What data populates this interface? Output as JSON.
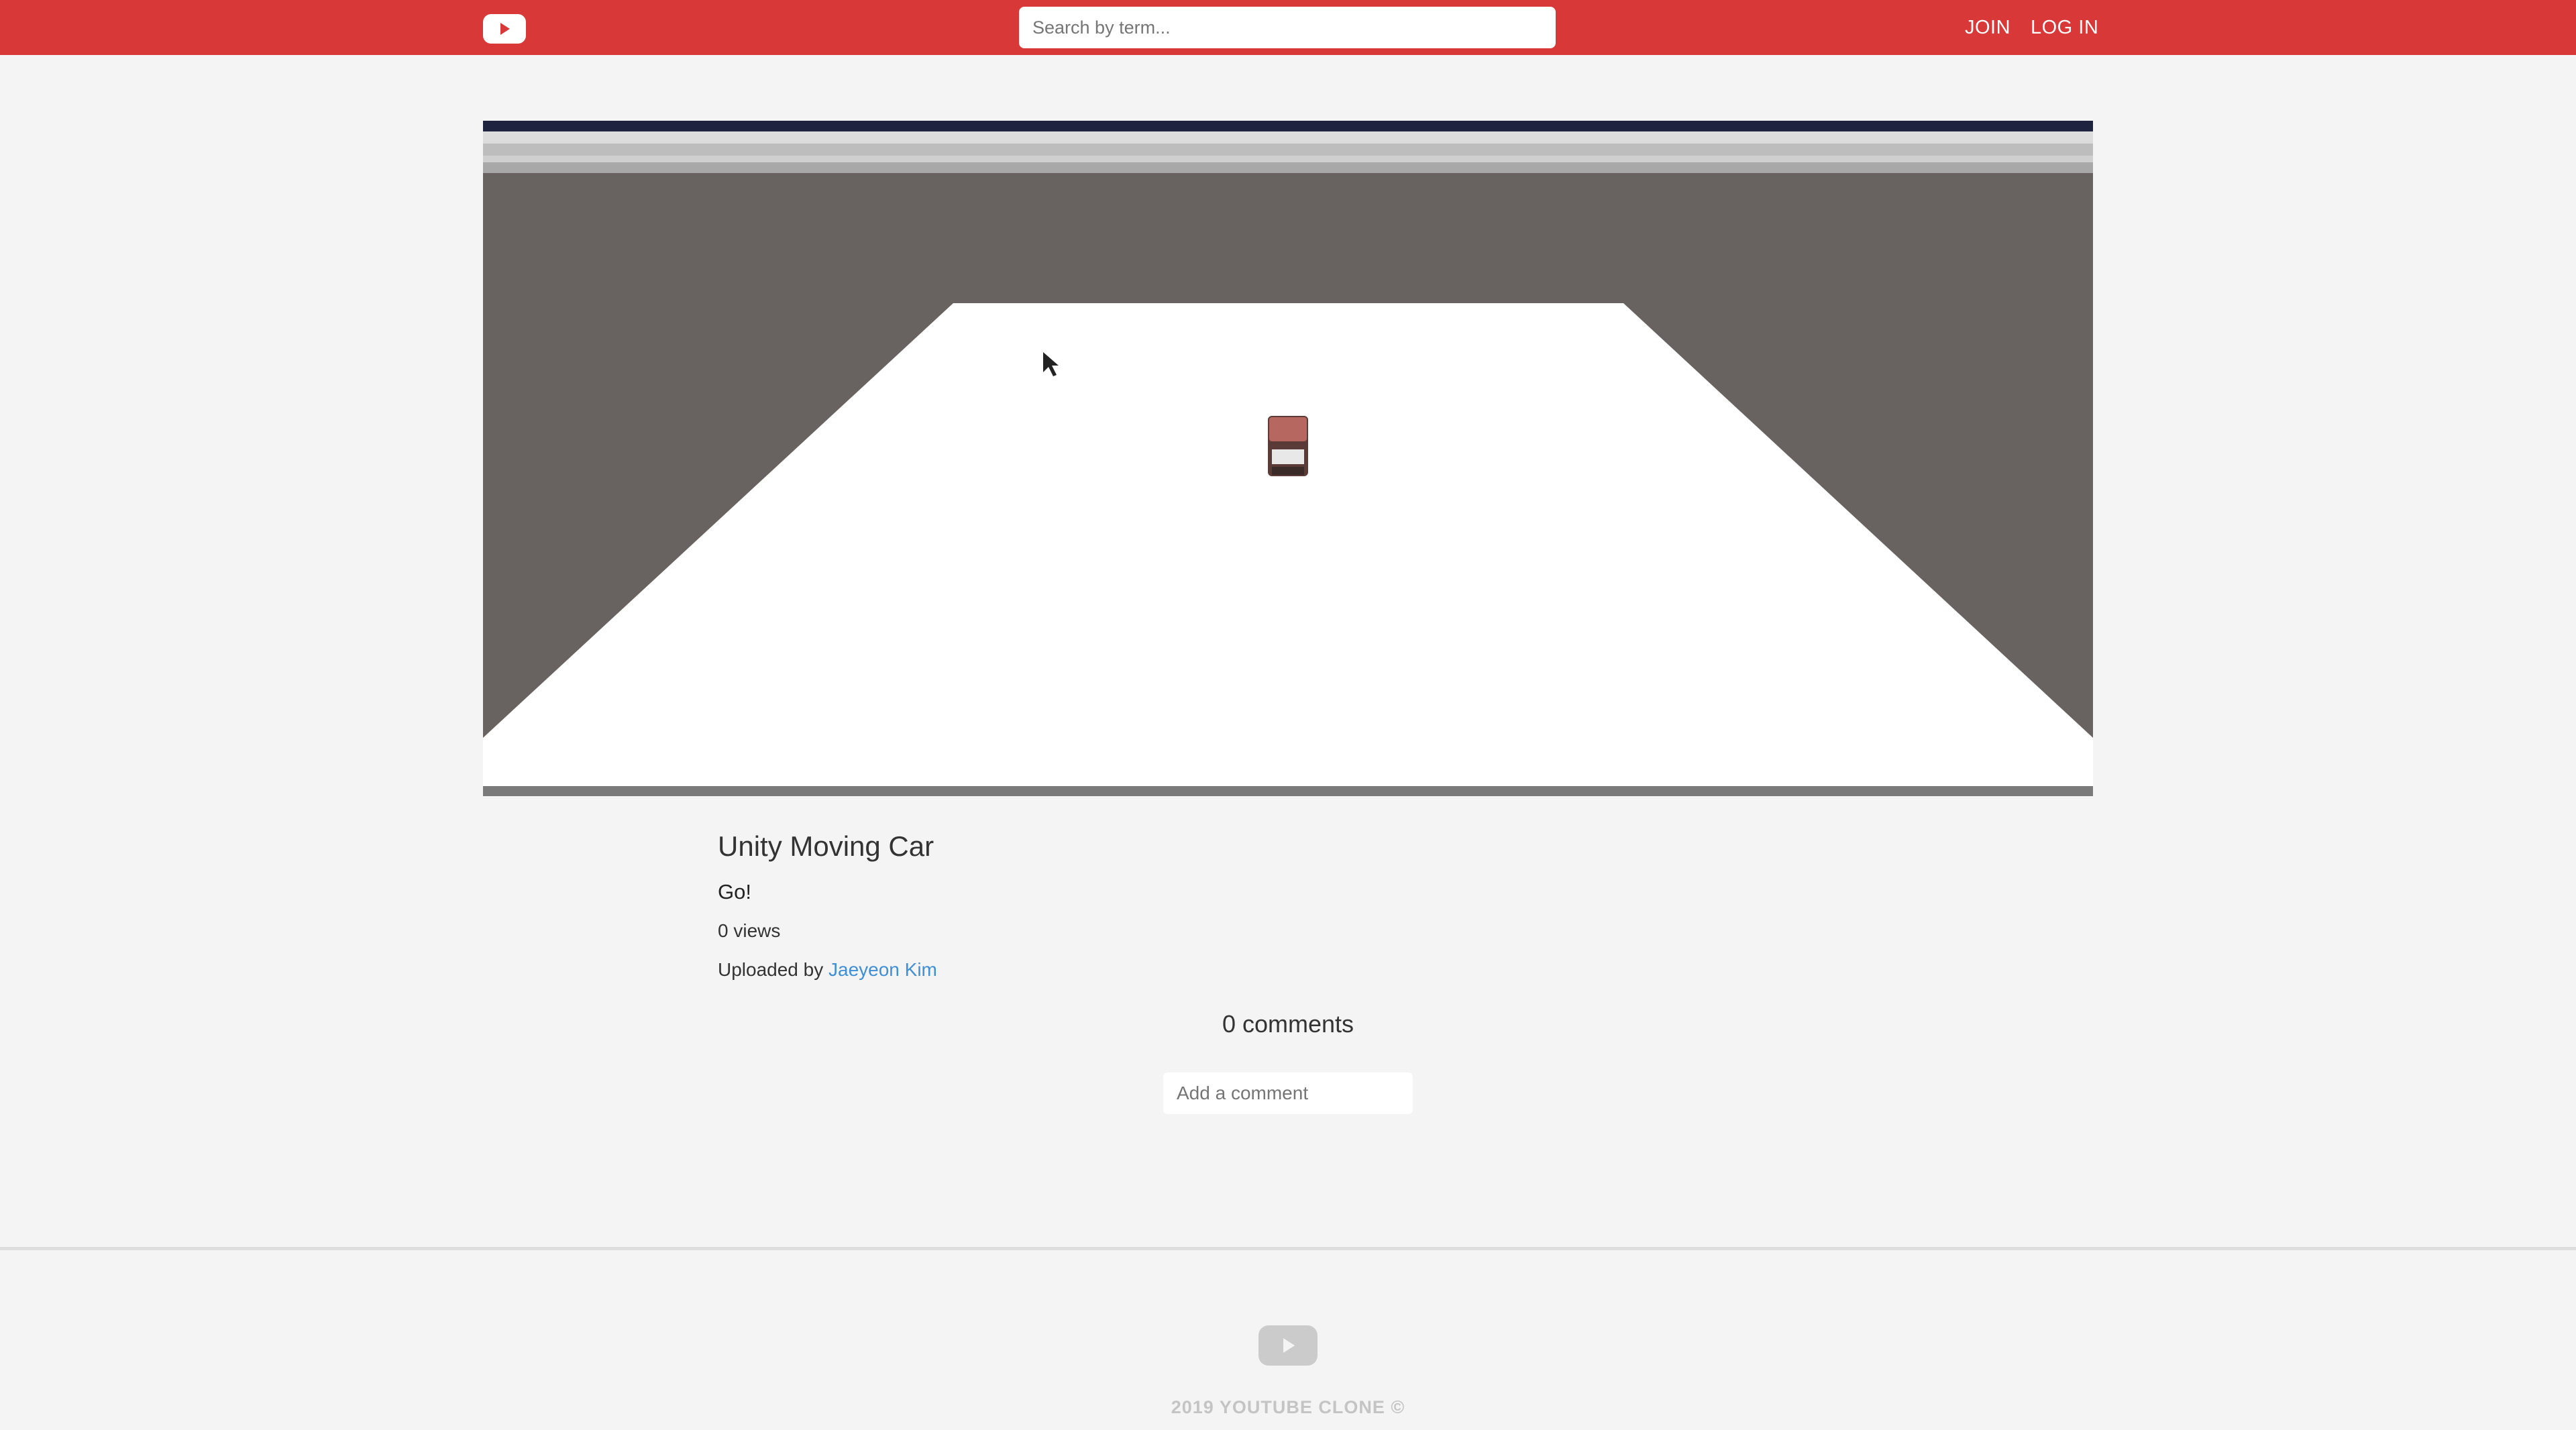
{
  "app": {
    "logo_icon": "play-icon"
  },
  "header": {
    "search": {
      "placeholder": "Search by term...",
      "value": ""
    },
    "join_label": "JOIN",
    "login_label": "LOG IN"
  },
  "video": {
    "title": "Unity Moving Car",
    "description": "Go!",
    "views": "0 views",
    "uploaded_prefix": "Uploaded by ",
    "uploader": "Jaeyeon Kim",
    "progress": 0
  },
  "comments": {
    "count_label": "0 comments",
    "input_placeholder": "Add a comment"
  },
  "footer": {
    "logo_icon": "play-icon",
    "copyright": "2019 YOUTUBE CLONE ©"
  },
  "colors": {
    "header": "#d93838",
    "background": "#f4f4f4",
    "link": "#3e8fd6"
  }
}
